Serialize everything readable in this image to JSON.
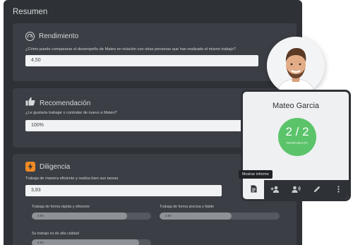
{
  "summary": {
    "title": "Resumen",
    "sections": [
      {
        "title": "Rendimiento",
        "icon": "gauge-icon",
        "question": "¿Cómo puede compararse el desempeño de Mateo en relación con otras personas que han realizado el mismo trabajo?",
        "answer": "4,50"
      },
      {
        "title": "Recomendación",
        "icon": "thumbs-up-icon",
        "question": "¿Le gustaría trabajar o contratar de nuevo a Mateo?",
        "answer": "100%"
      },
      {
        "title": "Diligencia",
        "icon": "bolt-icon",
        "accent": "#f28a24",
        "question": "Trabaja de manera eficiente y realiza bien sus tareas",
        "answer": "3,83",
        "subitems": [
          {
            "label": "Trabaja de forma rápida y eficiente",
            "value": "4.00",
            "fraction": 0.8
          },
          {
            "label": "Trabaja de forma precisa y fiable",
            "value": "3.00",
            "fraction": 0.6
          },
          {
            "label": "Su trabajo es de alta calidad",
            "value": "4.50",
            "fraction": 0.9
          }
        ]
      }
    ]
  },
  "profile": {
    "name": "Mateo Garcia",
    "count": "2 / 2",
    "count_label": "RESPUESTA",
    "accent": "#5bc46a",
    "toolbar": [
      {
        "icon": "document-icon",
        "active": true
      },
      {
        "icon": "add-person-icon",
        "active": false
      },
      {
        "icon": "voice-icon",
        "active": false
      },
      {
        "icon": "pencil-icon",
        "active": false
      },
      {
        "icon": "more-vertical-icon",
        "active": false
      }
    ]
  },
  "tooltip": "Mostrar informe"
}
